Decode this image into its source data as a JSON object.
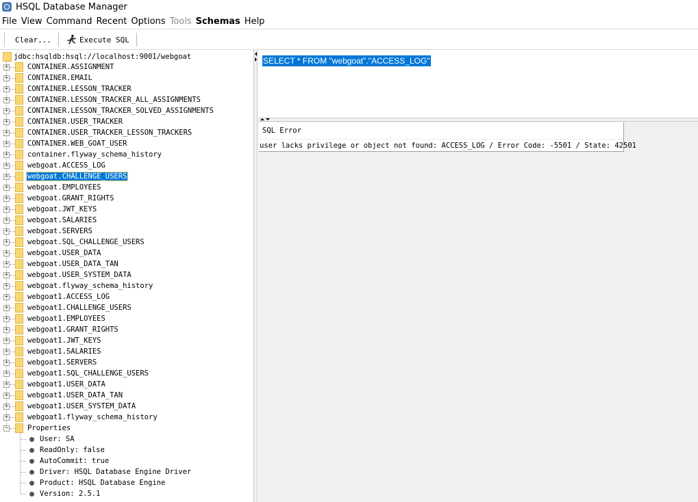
{
  "window": {
    "title": "HSQL Database Manager"
  },
  "menu": [
    {
      "label": "File",
      "state": "normal"
    },
    {
      "label": "View",
      "state": "normal"
    },
    {
      "label": "Command",
      "state": "normal"
    },
    {
      "label": "Recent",
      "state": "normal"
    },
    {
      "label": "Options",
      "state": "normal"
    },
    {
      "label": "Tools",
      "state": "disabled"
    },
    {
      "label": "Schemas",
      "state": "bold"
    },
    {
      "label": "Help",
      "state": "normal"
    }
  ],
  "toolbar": {
    "clear_label": "Clear...",
    "execute_label": "Execute SQL"
  },
  "tree": {
    "root": "jdbc:hsqldb:hsql://localhost:9001/webgoat",
    "tables": [
      "CONTAINER.ASSIGNMENT",
      "CONTAINER.EMAIL",
      "CONTAINER.LESSON_TRACKER",
      "CONTAINER.LESSON_TRACKER_ALL_ASSIGNMENTS",
      "CONTAINER.LESSON_TRACKER_SOLVED_ASSIGNMENTS",
      "CONTAINER.USER_TRACKER",
      "CONTAINER.USER_TRACKER_LESSON_TRACKERS",
      "CONTAINER.WEB_GOAT_USER",
      "container.flyway_schema_history",
      "webgoat.ACCESS_LOG",
      "webgoat.CHALLENGE_USERS",
      "webgoat.EMPLOYEES",
      "webgoat.GRANT_RIGHTS",
      "webgoat.JWT_KEYS",
      "webgoat.SALARIES",
      "webgoat.SERVERS",
      "webgoat.SQL_CHALLENGE_USERS",
      "webgoat.USER_DATA",
      "webgoat.USER_DATA_TAN",
      "webgoat.USER_SYSTEM_DATA",
      "webgoat.flyway_schema_history",
      "webgoat1.ACCESS_LOG",
      "webgoat1.CHALLENGE_USERS",
      "webgoat1.EMPLOYEES",
      "webgoat1.GRANT_RIGHTS",
      "webgoat1.JWT_KEYS",
      "webgoat1.SALARIES",
      "webgoat1.SERVERS",
      "webgoat1.SQL_CHALLENGE_USERS",
      "webgoat1.USER_DATA",
      "webgoat1.USER_DATA_TAN",
      "webgoat1.USER_SYSTEM_DATA",
      "webgoat1.flyway_schema_history"
    ],
    "selected": "webgoat.CHALLENGE_USERS",
    "properties_label": "Properties",
    "properties": [
      "User: SA",
      "ReadOnly: false",
      "AutoCommit: true",
      "Driver: HSQL Database Engine Driver",
      "Product: HSQL Database Engine",
      "Version: 2.5.1"
    ]
  },
  "editor": {
    "sql": "SELECT * FROM \"webgoat\".\"ACCESS_LOG\""
  },
  "result": {
    "header": "SQL Error",
    "message": "user lacks privilege or object not found: ACCESS_LOG / Error Code: -5501 / State: 42501"
  },
  "colors": {
    "selection": "#0078d7",
    "folder": "#f8d775"
  }
}
